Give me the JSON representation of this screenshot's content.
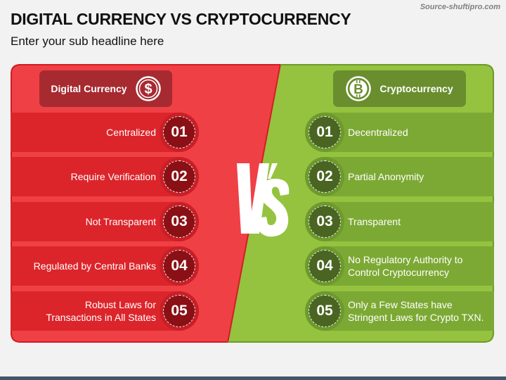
{
  "source": "Source-shuftipro.com",
  "title": "DIGITAL CURRENCY VS CRYPTOCURRENCY",
  "subtitle": "Enter your sub headline here",
  "vs_label": "VS",
  "colors": {
    "left_accent": "#dc252b",
    "right_accent": "#7ca934",
    "left_panel": "#ef4046",
    "right_panel": "#95c33f",
    "footer_bar": "#44546a"
  },
  "left": {
    "header": "Digital Currency",
    "icon": "dollar-coin-icon",
    "items": [
      {
        "num": "01",
        "text": "Centralized"
      },
      {
        "num": "02",
        "text": "Require Verification"
      },
      {
        "num": "03",
        "text": "Not Transparent"
      },
      {
        "num": "04",
        "text": "Regulated by Central Banks"
      },
      {
        "num": "05",
        "text_line1": "Robust Laws for",
        "text_line2": "Transactions in All States"
      }
    ]
  },
  "right": {
    "header": "Cryptocurrency",
    "icon": "bitcoin-icon",
    "items": [
      {
        "num": "01",
        "text": "Decentralized"
      },
      {
        "num": "02",
        "text": "Partial Anonymity"
      },
      {
        "num": "03",
        "text": "Transparent"
      },
      {
        "num": "04",
        "text_line1": "No Regulatory Authority to",
        "text_line2": "Control Cryptocurrency"
      },
      {
        "num": "05",
        "text_line1": "Only a Few States have",
        "text_line2": "Stringent Laws for Crypto TXN."
      }
    ]
  }
}
